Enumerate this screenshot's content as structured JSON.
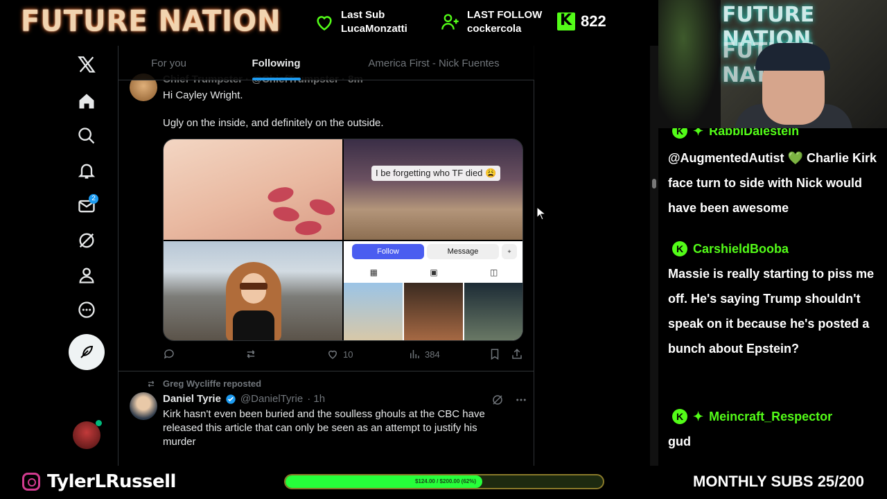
{
  "overlay": {
    "logo_text": "FUTURE NATION",
    "last_sub": {
      "label": "Last Sub",
      "name": "LucaMonzatti"
    },
    "last_follow": {
      "label": "LAST FOLLOW",
      "name": "cockercola"
    },
    "kick_count": "822",
    "bottom": {
      "instagram_handle": "TylerLRussell",
      "goal_text": "$124.00 / $200.00 (62%)",
      "goal_progress": 0.62,
      "monthly_subs": "MONTHLY SUBS 25/200"
    }
  },
  "x": {
    "nav": {
      "items": [
        "x-logo",
        "home",
        "explore",
        "notifications",
        "messages",
        "grok",
        "profile",
        "more"
      ],
      "messages_badge": "2"
    },
    "tabs": [
      {
        "label": "For you",
        "active": false
      },
      {
        "label": "Following",
        "active": true
      },
      {
        "label": "America First - Nick Fuentes",
        "active": false
      }
    ],
    "tweet1": {
      "header_partial": "Chief Trumpster · @ChiefTrumpster · 8m",
      "line1": "Hi Cayley Wright.",
      "line2": "Ugly on the inside, and definitely on the outside.",
      "image_caption": "I be forgetting who TF died 😩",
      "ig_follow": "Follow",
      "ig_message": "Message",
      "likes": "10",
      "views": "384"
    },
    "tweet2": {
      "reposted_by": "Greg Wycliffe reposted",
      "name": "Daniel Tyrie",
      "handle": "@DanielTyrie",
      "time": "· 1h",
      "body": "Kirk hasn't even been buried and the soulless ghouls at the CBC have released this article that can only be seen as an attempt to justify his murder"
    }
  },
  "webcam": {
    "neon_text": "FUTURE NATION"
  },
  "chat": {
    "partial_user": "RabbiDalestein",
    "messages": [
      {
        "user": "",
        "text": "@AugmentedAutist 💚 Charlie Kirk face turn to side with Nick would have been awesome"
      },
      {
        "user": "CarshieldBooba",
        "text": "Massie is really starting to piss me off. He's saying Trump shouldn't speak on it because he's posted a bunch about Epstein?"
      },
      {
        "user": "Meincraft_Respector",
        "text": "gud"
      }
    ]
  },
  "colors": {
    "kick_green": "#53fc18",
    "x_blue": "#1d9bf0",
    "x_muted": "#71767b"
  }
}
